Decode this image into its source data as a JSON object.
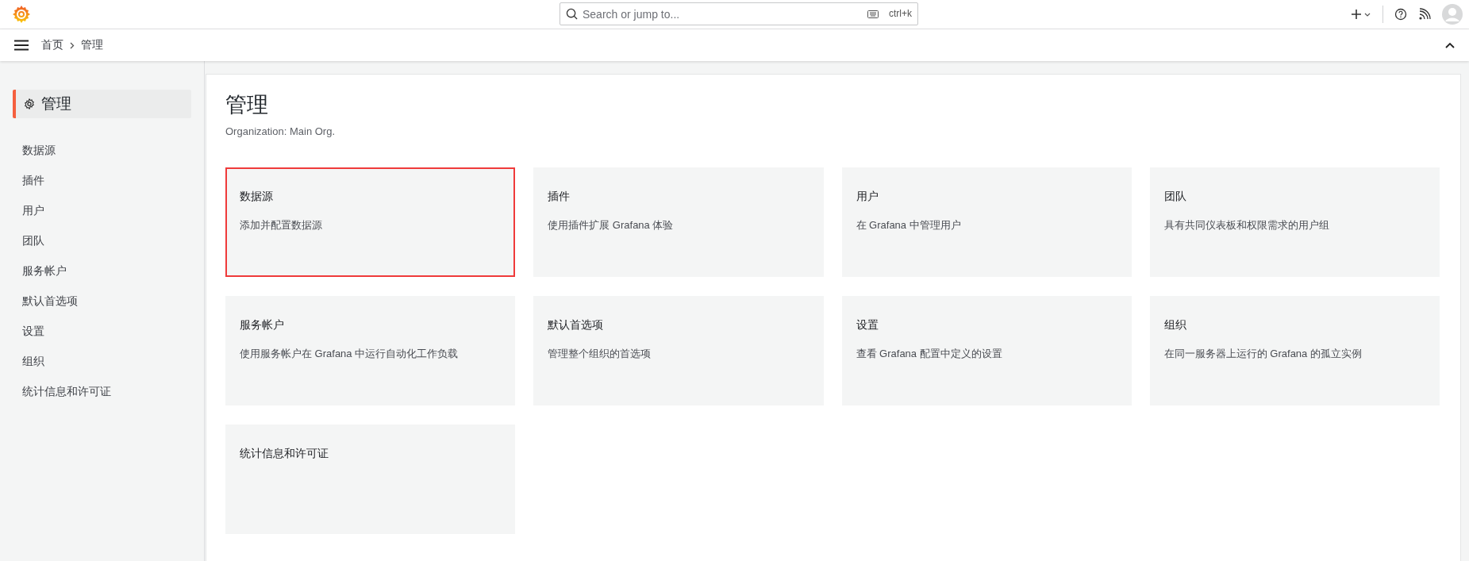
{
  "top_bar": {
    "search": {
      "placeholder": "Search or jump to...",
      "shortcut": "ctrl+k"
    }
  },
  "breadcrumb": [
    "首页",
    "管理"
  ],
  "sidebar": {
    "title": "管理",
    "selected": true,
    "items": [
      "数据源",
      "插件",
      "用户",
      "团队",
      "服务帐户",
      "默认首选项",
      "设置",
      "组织",
      "统计信息和许可证"
    ]
  },
  "page": {
    "title": "管理",
    "subtitle": "Organization: Main Org.",
    "cards": [
      {
        "title": "数据源",
        "description": "添加并配置数据源",
        "highlighted": true
      },
      {
        "title": "插件",
        "description": "使用插件扩展 Grafana 体验",
        "highlighted": false
      },
      {
        "title": "用户",
        "description": "在 Grafana 中管理用户",
        "highlighted": false
      },
      {
        "title": "团队",
        "description": "具有共同仪表板和权限需求的用户组",
        "highlighted": false
      },
      {
        "title": "服务帐户",
        "description": "使用服务帐户在 Grafana 中运行自动化工作负载",
        "highlighted": false
      },
      {
        "title": "默认首选项",
        "description": "管理整个组织的首选项",
        "highlighted": false
      },
      {
        "title": "设置",
        "description": "查看 Grafana 配置中定义的设置",
        "highlighted": false
      },
      {
        "title": "组织",
        "description": "在同一服务器上运行的 Grafana 的孤立实例",
        "highlighted": false
      },
      {
        "title": "统计信息和许可证",
        "highlighted": false
      }
    ]
  }
}
